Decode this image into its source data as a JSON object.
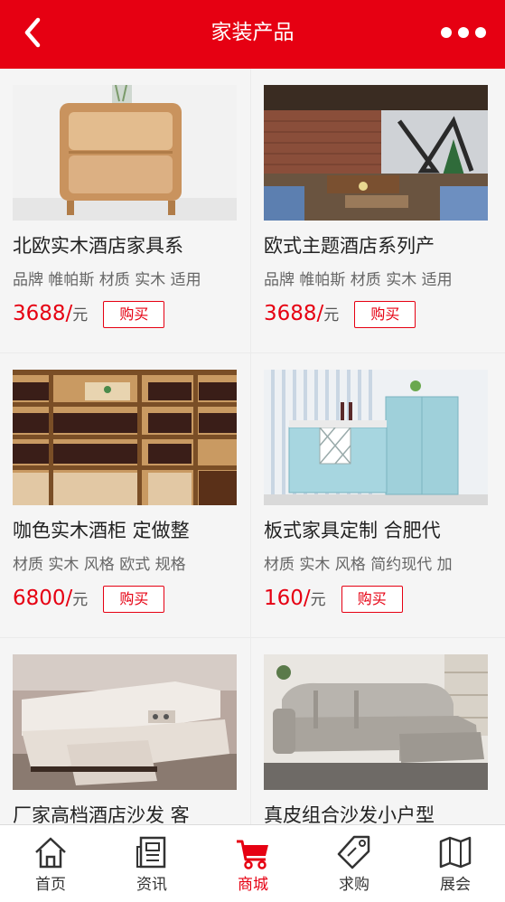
{
  "header": {
    "title": "家装产品",
    "back_icon": "chevron-left-icon",
    "more_icon": "more-dots-icon",
    "background": "#e60012"
  },
  "products": [
    {
      "title": "北欧实木酒店家具系",
      "desc": "品牌 帷帕斯 材质 实木 适用",
      "price": "3688/",
      "unit": "元",
      "buy": "购买",
      "image": "nightstand"
    },
    {
      "title": "欧式主题酒店系列产",
      "desc": "品牌 帷帕斯 材质 实木 适用",
      "price": "3688/",
      "unit": "元",
      "buy": "购买",
      "image": "themed-lounge"
    },
    {
      "title": "咖色实木酒柜 定做整",
      "desc": "材质 实木 风格 欧式 规格",
      "price": "6800/",
      "unit": "元",
      "buy": "购买",
      "image": "wine-cabinet"
    },
    {
      "title": "板式家具定制 合肥代",
      "desc": "材质 实木 风格 简约现代 加",
      "price": "160/",
      "unit": "元",
      "buy": "购买",
      "image": "blue-sideboard"
    },
    {
      "title": "厂家高档酒店沙发 客",
      "desc": "",
      "price": "",
      "unit": "",
      "buy": "",
      "image": "white-leather-sofa"
    },
    {
      "title": "真皮组合沙发小户型",
      "desc": "",
      "price": "",
      "unit": "",
      "buy": "",
      "image": "grey-leather-sofa"
    }
  ],
  "tabbar": [
    {
      "label": "首页",
      "icon": "home-icon",
      "active": false
    },
    {
      "label": "资讯",
      "icon": "news-icon",
      "active": false
    },
    {
      "label": "商城",
      "icon": "cart-icon",
      "active": true
    },
    {
      "label": "求购",
      "icon": "tag-icon",
      "active": false
    },
    {
      "label": "展会",
      "icon": "map-icon",
      "active": false
    }
  ],
  "colors": {
    "accent": "#e60012",
    "text": "#222222",
    "muted": "#666666"
  }
}
